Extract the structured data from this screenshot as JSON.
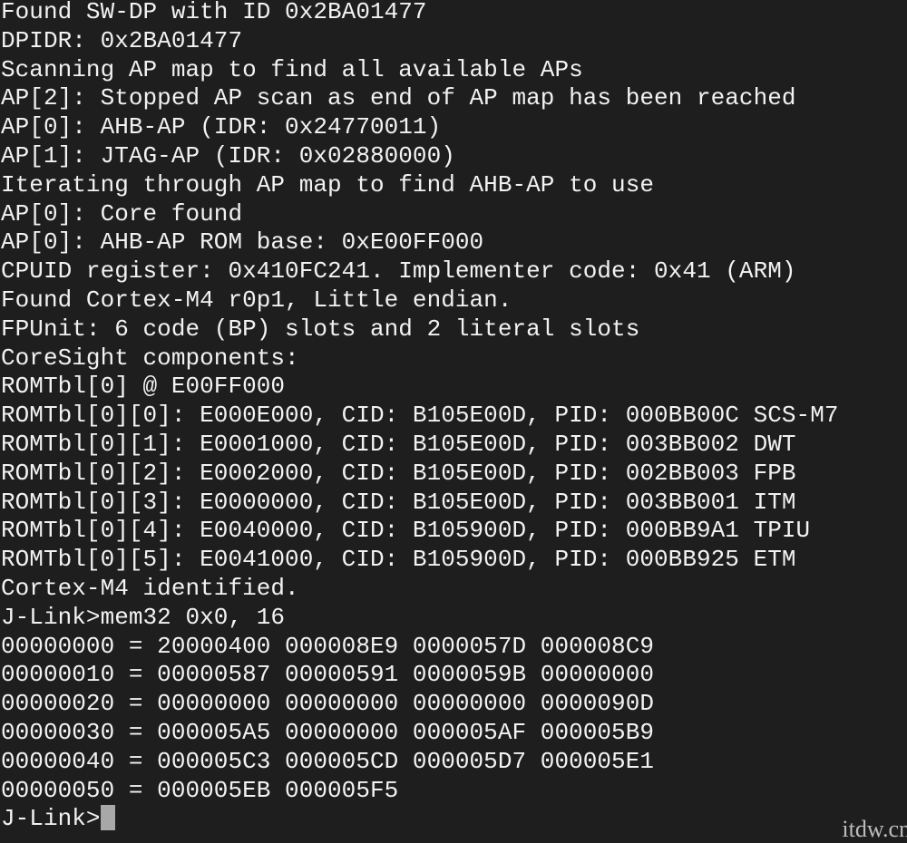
{
  "terminal": {
    "lines": [
      "Found SW-DP with ID 0x2BA01477",
      "DPIDR: 0x2BA01477",
      "Scanning AP map to find all available APs",
      "AP[2]: Stopped AP scan as end of AP map has been reached",
      "AP[0]: AHB-AP (IDR: 0x24770011)",
      "AP[1]: JTAG-AP (IDR: 0x02880000)",
      "Iterating through AP map to find AHB-AP to use",
      "AP[0]: Core found",
      "AP[0]: AHB-AP ROM base: 0xE00FF000",
      "CPUID register: 0x410FC241. Implementer code: 0x41 (ARM)",
      "Found Cortex-M4 r0p1, Little endian.",
      "FPUnit: 6 code (BP) slots and 2 literal slots",
      "CoreSight components:",
      "ROMTbl[0] @ E00FF000",
      "ROMTbl[0][0]: E000E000, CID: B105E00D, PID: 000BB00C SCS-M7",
      "ROMTbl[0][1]: E0001000, CID: B105E00D, PID: 003BB002 DWT",
      "ROMTbl[0][2]: E0002000, CID: B105E00D, PID: 002BB003 FPB",
      "ROMTbl[0][3]: E0000000, CID: B105E00D, PID: 003BB001 ITM",
      "ROMTbl[0][4]: E0040000, CID: B105900D, PID: 000BB9A1 TPIU",
      "ROMTbl[0][5]: E0041000, CID: B105900D, PID: 000BB925 ETM",
      "Cortex-M4 identified.",
      "J-Link>mem32 0x0, 16",
      "00000000 = 20000400 000008E9 0000057D 000008C9",
      "00000010 = 00000587 00000591 0000059B 00000000",
      "00000020 = 00000000 00000000 00000000 0000090D",
      "00000030 = 000005A5 00000000 000005AF 000005B9",
      "00000040 = 000005C3 000005CD 000005D7 000005E1",
      "00000050 = 000005EB 000005F5"
    ],
    "prompt": "J-Link>",
    "input_value": ""
  },
  "watermark": "itdw.cn",
  "colors": {
    "background": "#1e1e1e",
    "text": "#f2f2f2",
    "cursor": "#a8a8a8"
  }
}
